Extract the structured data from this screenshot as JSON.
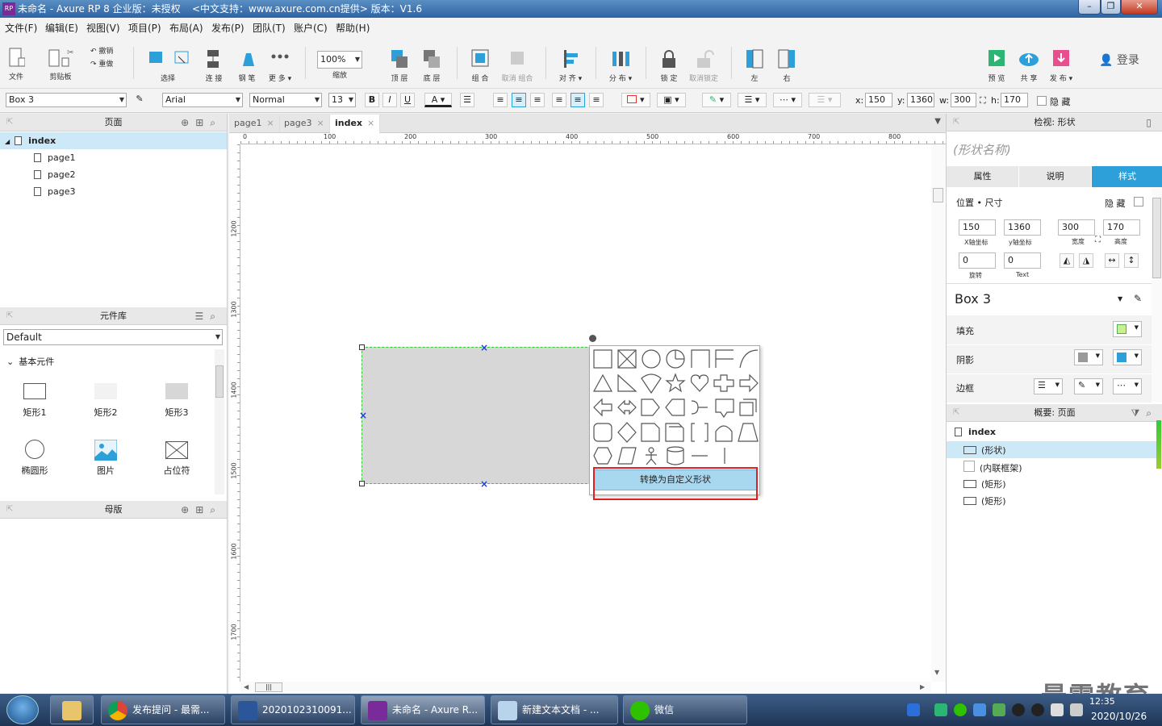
{
  "window": {
    "title": "未命名 - Axure RP 8 企业版：未授权",
    "title_extra": "<中文支持：www.axure.com.cn提供> 版本：V1.6"
  },
  "menu": [
    "文件(F)",
    "编辑(E)",
    "视图(V)",
    "项目(P)",
    "布局(A)",
    "发布(P)",
    "团队(T)",
    "账户(C)",
    "帮助(H)"
  ],
  "toolbar": {
    "file": "文件",
    "clipboard": "剪贴板",
    "undo": "撤销",
    "redo": "重做",
    "select": "选择",
    "connect": "连 接",
    "pen": "钢 笔",
    "more": "更 多 ▾",
    "zoom_value": "100%",
    "zoom_label": "缩放",
    "top_layer": "顶 层",
    "bottom_layer": "底 层",
    "group": "组 合",
    "ungroup": "取消 组合",
    "align": "对 齐 ▾",
    "distribute": "分 布 ▾",
    "lock": "锁 定",
    "unlock": "取消锁定",
    "left": "左",
    "right": "右",
    "preview": "预 览",
    "share": "共 享",
    "publish": "发 布 ▾",
    "login": "登录"
  },
  "format": {
    "widget_name": "Box 3",
    "font": "Arial",
    "style": "Normal",
    "size": "13",
    "bold": "B",
    "italic": "I",
    "underline": "U",
    "text_color": "A",
    "x_label": "x:",
    "x": "150",
    "y_label": "y:",
    "y": "1360",
    "w_label": "w:",
    "w": "300",
    "h_label": "h:",
    "h": "170",
    "hidden": "隐 藏"
  },
  "pages": {
    "header": "页面",
    "root": "index",
    "children": [
      "page1",
      "page2",
      "page3"
    ]
  },
  "library": {
    "header": "元件库",
    "selected": "Default",
    "group": "基本元件",
    "items": [
      "矩形1",
      "矩形2",
      "矩形3",
      "椭圆形",
      "图片",
      "占位符"
    ]
  },
  "masters": {
    "header": "母版"
  },
  "tabs": [
    {
      "label": "page1",
      "close": "×"
    },
    {
      "label": "page3",
      "close": "×"
    },
    {
      "label": "index",
      "close": "×"
    }
  ],
  "ruler": {
    "h_ticks": [
      "0",
      "100",
      "200",
      "300",
      "400",
      "500",
      "600",
      "700",
      "800"
    ],
    "v_ticks": [
      "1200",
      "1300",
      "1400",
      "1500",
      "1600",
      "1700"
    ]
  },
  "shape_menu": {
    "convert": "转换为自定义形状"
  },
  "inspector": {
    "header": "检视: 形状",
    "shape_name_placeholder": "(形状名称)",
    "tabs": [
      "属性",
      "说明",
      "样式"
    ],
    "section_pos": "位置 • 尺寸",
    "hidden": "隐 藏",
    "x": "150",
    "y": "1360",
    "w": "300",
    "h": "170",
    "x_cap": "X轴坐标",
    "y_cap": "y轴坐标",
    "w_cap": "宽度",
    "h_cap": "高度",
    "rot": "0",
    "rot_cap": "旋转",
    "text_rot": "0",
    "text_cap": "Text",
    "style_name": "Box 3",
    "fill": "填充",
    "shadow": "阴影",
    "border": "边框"
  },
  "outline": {
    "header": "概要: 页面",
    "root": "index",
    "items": [
      "(形状)",
      "(内联框架)",
      "(矩形)",
      "(矩形)"
    ]
  },
  "taskbar": {
    "tasks": [
      "发布提问 - 最需...",
      "2020102310091...",
      "未命名 - Axure R...",
      "新建文本文档 - ...",
      "微信"
    ],
    "date": "2020/10/26",
    "time": "12:35",
    "watermark": "最需教育"
  }
}
